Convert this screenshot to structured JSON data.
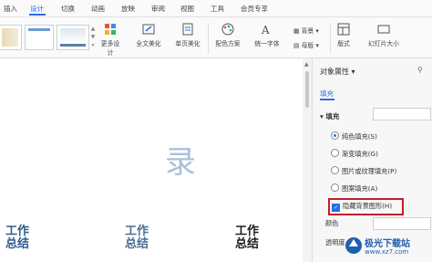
{
  "menu": {
    "tabs": [
      {
        "label": "插入"
      },
      {
        "label": "设计"
      },
      {
        "label": "切换"
      },
      {
        "label": "动画"
      },
      {
        "label": "放映"
      },
      {
        "label": "审阅"
      },
      {
        "label": "视图"
      },
      {
        "label": "工具"
      },
      {
        "label": "会员专享"
      }
    ],
    "active_index": 1
  },
  "ribbon": {
    "more_design": "更多设计",
    "beautify_all": "全文美化",
    "single_page_beautify": "单页美化",
    "color_scheme": "配色方案",
    "unified_font": "统一字体",
    "background": "背景",
    "master": "母版",
    "layout": "版式",
    "slide_size": "幻灯片大小"
  },
  "slide": {
    "big_char": "录",
    "titles": [
      {
        "top": "工作",
        "bottom": "总结"
      },
      {
        "top": "工作",
        "bottom": "总结"
      },
      {
        "top": "工作",
        "bottom": "总结"
      }
    ]
  },
  "panel": {
    "title": "对象属性",
    "tab": "填充",
    "section": "填充",
    "options": [
      {
        "label": "纯色填充(S)",
        "selected": true
      },
      {
        "label": "渐变填充(G)",
        "selected": false
      },
      {
        "label": "图片或纹理填充(P)",
        "selected": false
      },
      {
        "label": "图案填充(A)",
        "selected": false
      }
    ],
    "hide_bg_checkbox": {
      "label": "隐藏背景图形(H)",
      "checked": true
    },
    "color_label": "颜色",
    "opacity_label": "透明度",
    "accent": "#2b6de8",
    "highlight": "#c0202a"
  },
  "watermark": {
    "name": "极光下载站",
    "url": "www.xz7.com"
  }
}
